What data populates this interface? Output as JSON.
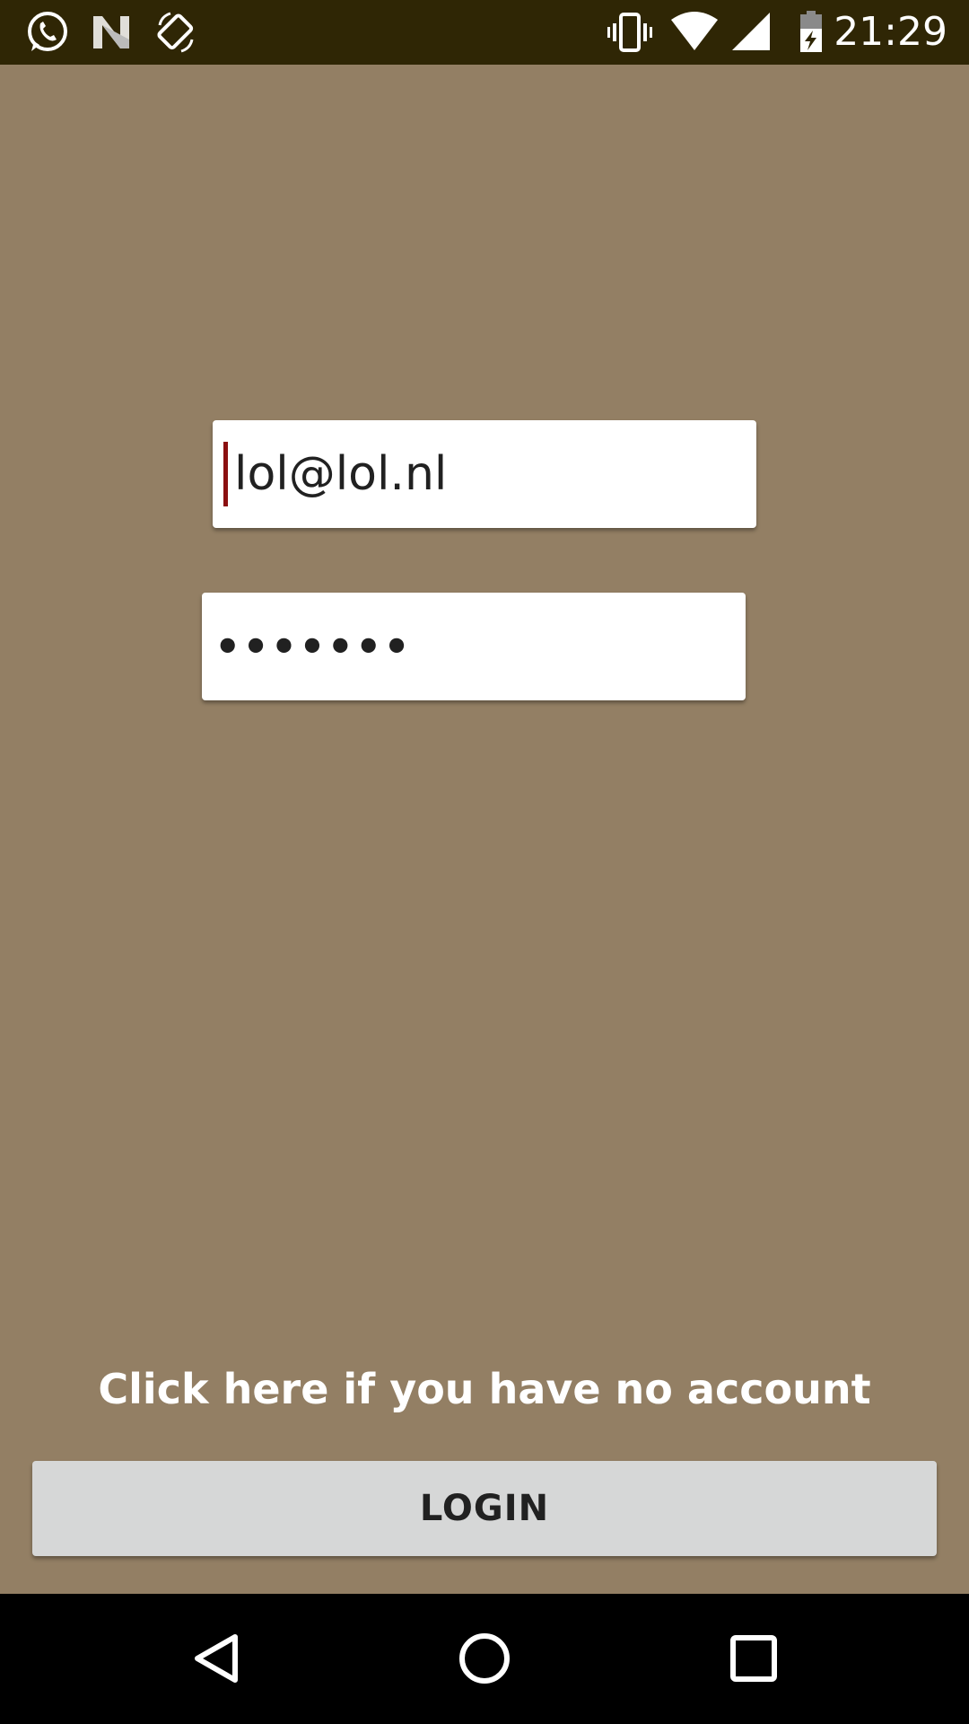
{
  "status_bar": {
    "time": "21:29",
    "left_icons": [
      "whatsapp-icon",
      "n-app-icon",
      "screen-rotation-icon"
    ],
    "right_icons": [
      "vibrate-icon",
      "wifi-icon",
      "cell-signal-icon",
      "battery-charging-icon"
    ],
    "background_color": "#2f2605"
  },
  "login_form": {
    "email_value": "lol@lol.nl",
    "password_value": "•••••••",
    "signup_link_text": "Click here if you have no account",
    "login_button_label": "LOGIN"
  },
  "theme": {
    "background_color": "#937f64",
    "button_color": "#d6d7d7",
    "cursor_color": "#8b0f10"
  },
  "nav_bar": {
    "buttons": [
      "back-icon",
      "home-icon",
      "recents-icon"
    ]
  }
}
